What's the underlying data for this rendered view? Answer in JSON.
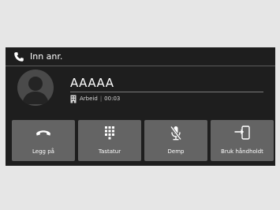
{
  "header": {
    "title": "Inn anr.",
    "icon": "phone-icon"
  },
  "caller": {
    "name": "AAAAA",
    "type_icon": "building-icon",
    "type": "Arbeid",
    "duration": "00:03"
  },
  "buttons": [
    {
      "label": "Legg på",
      "icon": "hang-up-icon"
    },
    {
      "label": "Tastatur",
      "icon": "keypad-icon"
    },
    {
      "label": "Demp",
      "icon": "mute-microphone-icon"
    },
    {
      "label": "Bruk håndholdt",
      "icon": "transfer-to-handset-icon"
    }
  ],
  "colors": {
    "screen_background": "#1e1e1e",
    "button_background": "#646464",
    "text": "#ffffff"
  }
}
